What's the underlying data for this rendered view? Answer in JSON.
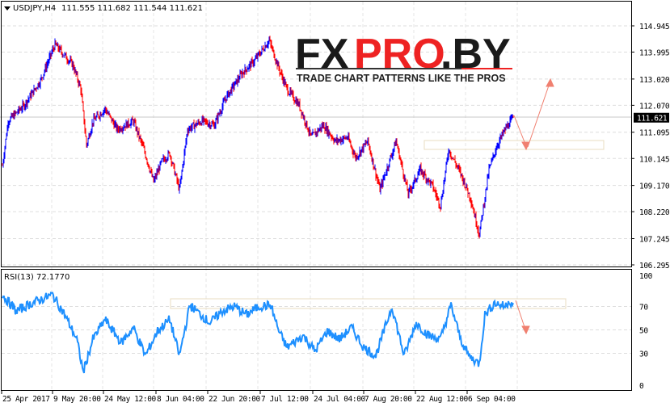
{
  "header": {
    "symbol": "USDJPY,H4",
    "ohlc": "111.555 111.682 111.544 111.621"
  },
  "price_axis": {
    "ticks": [
      "114.945",
      "113.995",
      "113.020",
      "112.070",
      "111.095",
      "110.145",
      "109.170",
      "108.220",
      "107.245",
      "106.295"
    ],
    "current": "111.621"
  },
  "rsi": {
    "label": "RSI(13) 72.1770",
    "ticks": [
      "100",
      "70",
      "50",
      "30",
      "0"
    ]
  },
  "time_axis": [
    "25 Apr 2017",
    "9 May 20:00",
    "24 May 12:00",
    "8 Jun 04:00",
    "22 Jun 20:00",
    "7 Jul 12:00",
    "24 Jul 04:00",
    "7 Aug 20:00",
    "22 Aug 12:00",
    "6 Sep 04:00"
  ],
  "logo": {
    "main_a": "FX",
    "main_b": "PRO",
    "main_c": ".BY",
    "tagline": "TRADE CHART PATTERNS LIKE THE PROS"
  },
  "colors": {
    "up": "#0000ff",
    "down": "#ff0000",
    "rsi": "#1e90ff",
    "annot": "#f08070"
  },
  "chart_data": {
    "type": "line",
    "title": "USDJPY,H4",
    "ylim": [
      106.295,
      114.945
    ],
    "price_path": [
      [
        0,
        109.89
      ],
      [
        7,
        111.5
      ],
      [
        27,
        112.08
      ],
      [
        47,
        112.96
      ],
      [
        65,
        114.27
      ],
      [
        87,
        113.54
      ],
      [
        97,
        112.66
      ],
      [
        104,
        110.62
      ],
      [
        112,
        111.5
      ],
      [
        127,
        111.94
      ],
      [
        142,
        111.2
      ],
      [
        162,
        111.5
      ],
      [
        175,
        110.47
      ],
      [
        187,
        109.3
      ],
      [
        197,
        110.03
      ],
      [
        207,
        110.33
      ],
      [
        219,
        109.01
      ],
      [
        229,
        111.2
      ],
      [
        247,
        111.5
      ],
      [
        262,
        111.35
      ],
      [
        277,
        112.37
      ],
      [
        297,
        113.25
      ],
      [
        312,
        113.69
      ],
      [
        330,
        114.42
      ],
      [
        342,
        113.4
      ],
      [
        352,
        112.66
      ],
      [
        367,
        112.08
      ],
      [
        382,
        110.91
      ],
      [
        397,
        111.35
      ],
      [
        412,
        110.77
      ],
      [
        427,
        110.91
      ],
      [
        437,
        110.18
      ],
      [
        452,
        110.77
      ],
      [
        467,
        109.01
      ],
      [
        487,
        110.77
      ],
      [
        502,
        108.87
      ],
      [
        517,
        109.74
      ],
      [
        532,
        109.16
      ],
      [
        542,
        108.43
      ],
      [
        552,
        110.47
      ],
      [
        567,
        109.6
      ],
      [
        579,
        108.72
      ],
      [
        590,
        107.4
      ],
      [
        602,
        109.74
      ],
      [
        612,
        110.62
      ],
      [
        622,
        111.2
      ],
      [
        632,
        111.62
      ]
    ],
    "rsi_path": [
      [
        0,
        80
      ],
      [
        17,
        66
      ],
      [
        37,
        73
      ],
      [
        62,
        80
      ],
      [
        77,
        63
      ],
      [
        92,
        42
      ],
      [
        100,
        14
      ],
      [
        112,
        42
      ],
      [
        127,
        59
      ],
      [
        147,
        39
      ],
      [
        162,
        52
      ],
      [
        177,
        28
      ],
      [
        192,
        49
      ],
      [
        207,
        59
      ],
      [
        219,
        28
      ],
      [
        232,
        71
      ],
      [
        257,
        56
      ],
      [
        272,
        66
      ],
      [
        287,
        70
      ],
      [
        302,
        63
      ],
      [
        317,
        70
      ],
      [
        332,
        71
      ],
      [
        342,
        49
      ],
      [
        352,
        35
      ],
      [
        372,
        45
      ],
      [
        387,
        32
      ],
      [
        402,
        49
      ],
      [
        417,
        42
      ],
      [
        432,
        52
      ],
      [
        447,
        35
      ],
      [
        462,
        28
      ],
      [
        482,
        70
      ],
      [
        497,
        28
      ],
      [
        512,
        56
      ],
      [
        527,
        45
      ],
      [
        542,
        42
      ],
      [
        555,
        71
      ],
      [
        567,
        42
      ],
      [
        577,
        28
      ],
      [
        590,
        21
      ],
      [
        597,
        63
      ],
      [
        609,
        73
      ],
      [
        622,
        70
      ],
      [
        627,
        75
      ],
      [
        632,
        72
      ]
    ],
    "rsi_ylim": [
      0,
      100
    ]
  }
}
